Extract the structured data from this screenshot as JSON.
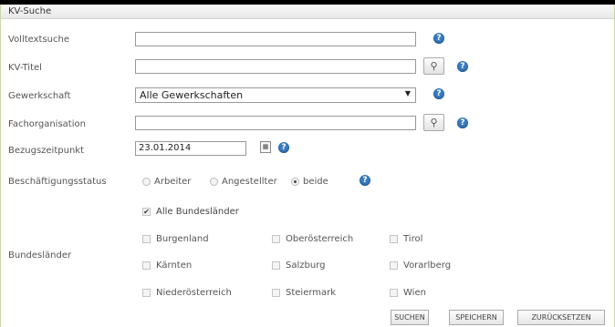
{
  "header": {
    "title": "KV-Suche"
  },
  "form": {
    "volltext": {
      "label": "Volltextsuche",
      "value": ""
    },
    "kv_titel": {
      "label": "KV-Titel",
      "value": ""
    },
    "gewerkschaft": {
      "label": "Gewerkschaft",
      "value": "Alle Gewerkschaften"
    },
    "fachorganisation": {
      "label": "Fachorganisation",
      "value": ""
    },
    "bezugszeitpunkt": {
      "label": "Bezugszeitpunkt",
      "value": "23.01.2014"
    },
    "status": {
      "label": "Beschäftigungsstatus",
      "options": [
        "Arbeiter",
        "Angestellter",
        "beide"
      ],
      "selected": "beide"
    },
    "bundeslaender": {
      "label": "Bundesländer",
      "all_label": "Alle Bundesländer",
      "all_checked": true,
      "items": [
        "Burgenland",
        "Oberösterreich",
        "Tirol",
        "Kärnten",
        "Salzburg",
        "Vorarlberg",
        "Niederösterreich",
        "Steiermark",
        "Wien"
      ]
    }
  },
  "buttons": {
    "suchen": "SUCHEN",
    "speichern": "SPEICHERN",
    "zuruecksetzen": "ZURÜCKSETZEN"
  },
  "icons": {
    "help": "help-icon",
    "lookup": "lookup-icon",
    "calendar": "calendar-icon"
  },
  "colors": {
    "help_blue": "#3a7cc0",
    "panel_border": "#c8d8a8",
    "header_bg": "#eeeeee"
  }
}
